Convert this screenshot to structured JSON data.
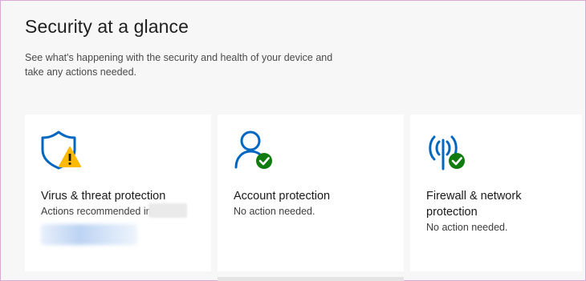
{
  "header": {
    "title": "Security at a glance",
    "subtitle": "See what's happening with the security and health of your device and take any actions needed."
  },
  "cards": [
    {
      "title": "Virus & threat protection",
      "status": "Actions recommended in",
      "icon": "shield-warning-icon",
      "status_color": "#ffb900"
    },
    {
      "title": "Account protection",
      "status": "No action needed.",
      "icon": "person-check-icon",
      "status_color": "#107c10"
    },
    {
      "title": "Firewall & network protection",
      "status": "No action needed.",
      "icon": "wifi-antenna-check-icon",
      "status_color": "#107c10"
    }
  ],
  "colors": {
    "accent": "#0067c0",
    "ok": "#107c10",
    "warning": "#ffb900"
  }
}
